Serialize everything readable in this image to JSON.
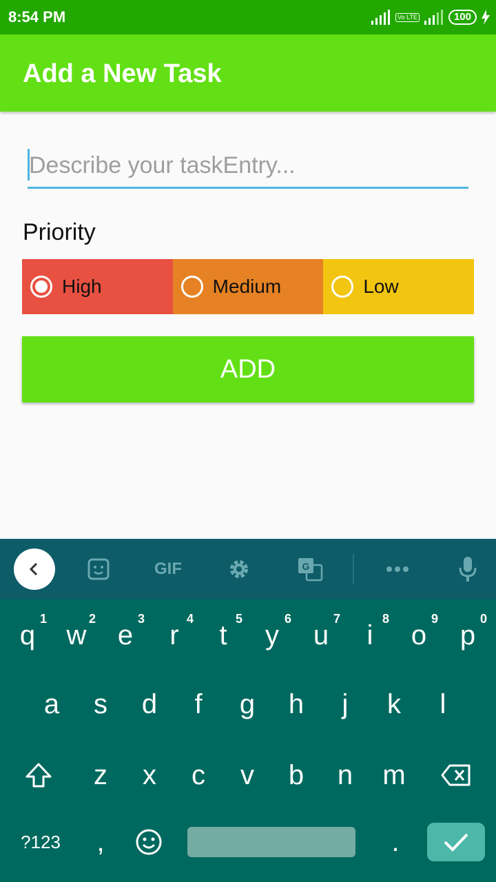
{
  "status_bar": {
    "time": "8:54 PM",
    "battery": "100",
    "volte": "Vo LTE"
  },
  "app_bar": {
    "title": "Add a New Task"
  },
  "form": {
    "placeholder": "Describe your taskEntry...",
    "value": "",
    "priority_label": "Priority",
    "priorities": [
      {
        "label": "High",
        "color": "#e85142",
        "selected": true
      },
      {
        "label": "Medium",
        "color": "#e68224",
        "selected": false
      },
      {
        "label": "Low",
        "color": "#f2c511",
        "selected": false
      }
    ],
    "add_label": "ADD"
  },
  "keyboard": {
    "toolbar_gif": "GIF",
    "row1": [
      {
        "k": "q",
        "h": "1"
      },
      {
        "k": "w",
        "h": "2"
      },
      {
        "k": "e",
        "h": "3"
      },
      {
        "k": "r",
        "h": "4"
      },
      {
        "k": "t",
        "h": "5"
      },
      {
        "k": "y",
        "h": "6"
      },
      {
        "k": "u",
        "h": "7"
      },
      {
        "k": "i",
        "h": "8"
      },
      {
        "k": "o",
        "h": "9"
      },
      {
        "k": "p",
        "h": "0"
      }
    ],
    "row2": [
      "a",
      "s",
      "d",
      "f",
      "g",
      "h",
      "j",
      "k",
      "l"
    ],
    "row3": [
      "z",
      "x",
      "c",
      "v",
      "b",
      "n",
      "m"
    ],
    "symbols_label": "?123",
    "comma": ",",
    "period": "."
  },
  "colors": {
    "status_bar": "#22a800",
    "app_bar": "#63e015",
    "input_underline": "#4fb4e0",
    "keyboard_toolbar": "#0d5c68",
    "keyboard": "#00695f"
  }
}
